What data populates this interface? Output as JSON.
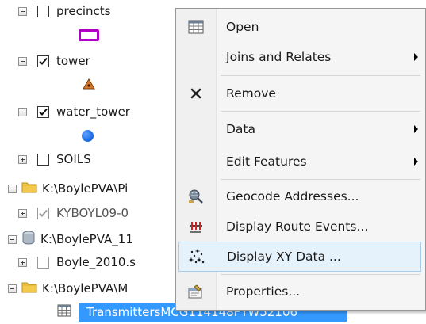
{
  "toc": {
    "layers": [
      {
        "name": "precincts"
      },
      {
        "name": "tower"
      },
      {
        "name": "water_tower"
      },
      {
        "name": "SOILS"
      },
      {
        "name": "K:\\BoylePVA\\Pi"
      },
      {
        "name": "KYBOYL09-0"
      },
      {
        "name": "K:\\BoylePVA_11"
      },
      {
        "name": "Boyle_2010.s"
      },
      {
        "name": "K:\\BoylePVA\\M"
      },
      {
        "name": "TransmittersMCG114148FYW52106"
      }
    ]
  },
  "context_menu": {
    "items": [
      {
        "label": "Open",
        "icon": "table-icon"
      },
      {
        "label": "Joins and Relates",
        "icon": "",
        "submenu": true
      },
      {
        "label": "Remove",
        "icon": "remove-x-icon"
      },
      {
        "label": "Data",
        "icon": "",
        "submenu": true
      },
      {
        "label": "Edit Features",
        "icon": "",
        "submenu": true
      },
      {
        "label": "Geocode Addresses...",
        "icon": "geocode-icon"
      },
      {
        "label": "Display Route Events...",
        "icon": "route-events-icon"
      },
      {
        "label": "Display XY Data ...",
        "icon": "xy-data-icon",
        "highlighted": true
      },
      {
        "label": "Properties...",
        "icon": "properties-icon"
      }
    ],
    "highlight_color": "#e5f1fb"
  },
  "colors": {
    "selection": "#3399ff",
    "precincts_symbol": "#b000c8",
    "tower_symbol": "#d4782a",
    "water_tower_symbol": "#1f6fe5",
    "folder": "#f3c94c"
  }
}
